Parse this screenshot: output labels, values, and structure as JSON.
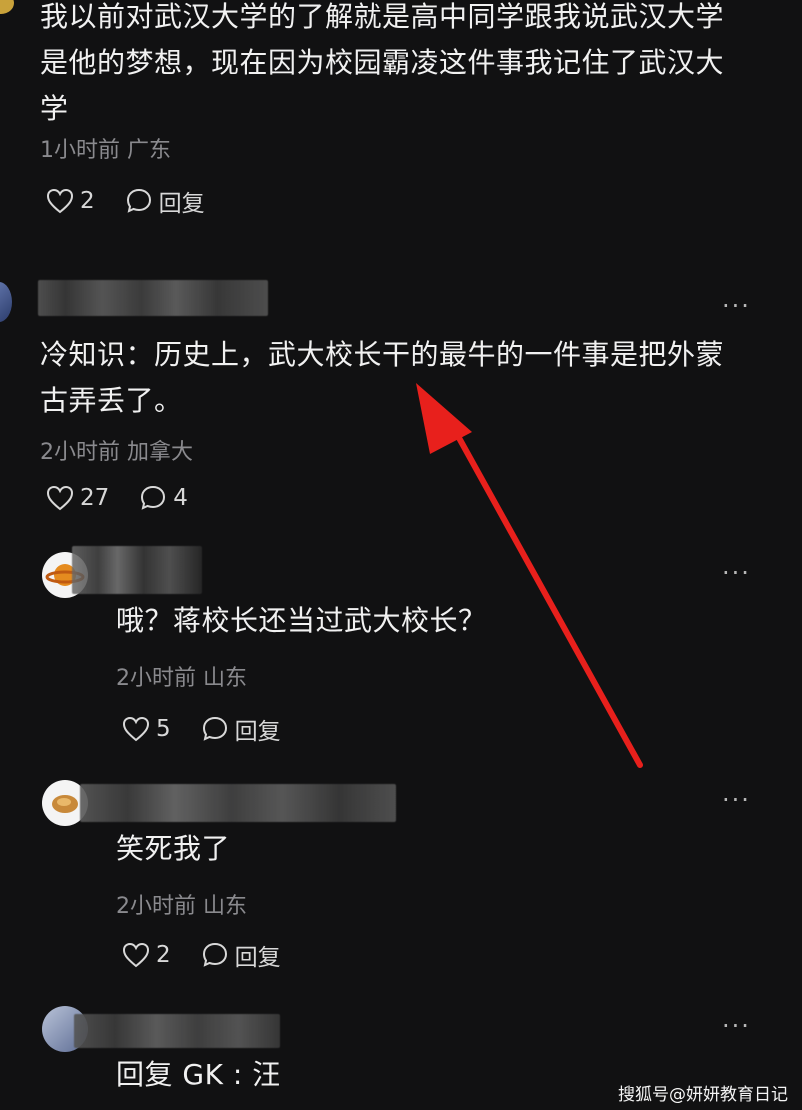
{
  "comments": [
    {
      "text": "我以前对武汉大学的了解就是高中同学跟我说武汉大学是他的梦想，现在因为校园霸凌这件事我记住了武汉大学",
      "line1": "我以前对武汉大学的了解就是高中同学跟我说武汉大学",
      "line2": "是他的梦想，现在因为校园霸凌这件事我记住了武汉大",
      "line3": "学",
      "meta": "1小时前 广东",
      "likes": "2",
      "reply_label": "回复"
    },
    {
      "username_partial": "花果山的糖果盒",
      "line1": "冷知识：历史上，武大校长干的最牛的一件事是把外蒙",
      "line2": "古弄丢了。",
      "meta": "2小时前 加拿大",
      "likes": "27",
      "replies": "4",
      "more": "···"
    }
  ],
  "replies": [
    {
      "text": "哦？蒋校长还当过武大校长？",
      "meta": "2小时前 山东",
      "likes": "5",
      "reply_label": "回复",
      "more": "···"
    },
    {
      "text": "笑死我了",
      "meta": "2小时前 山东",
      "likes": "2",
      "reply_label": "回复",
      "more": "···"
    },
    {
      "text": "回复 GK : 汪",
      "more": "···"
    }
  ],
  "watermark": "搜狐号@妍妍教育日记",
  "colors": {
    "arrow": "#e8201c",
    "background": "#111112",
    "meta": "#8a8a8e"
  }
}
